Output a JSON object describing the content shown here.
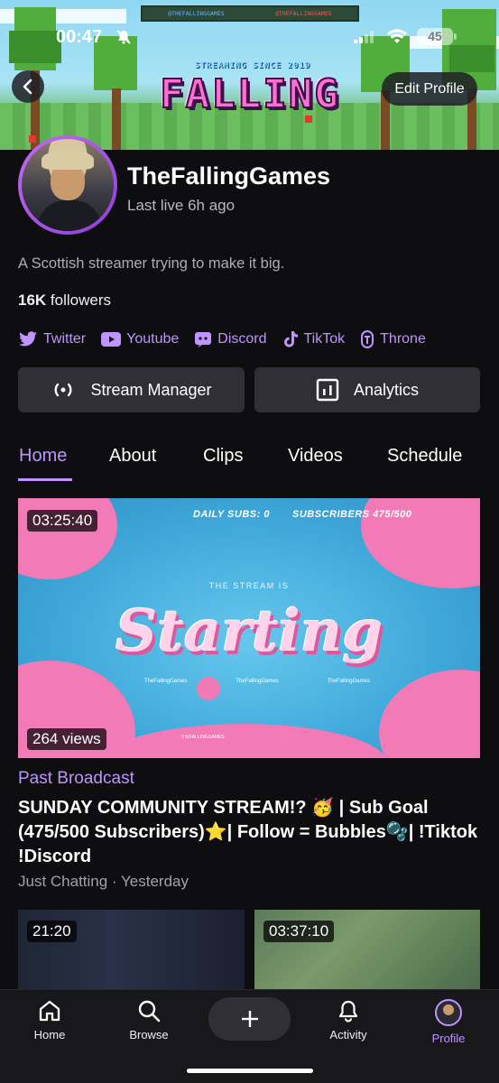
{
  "status_bar": {
    "time": "00:47",
    "battery": "45"
  },
  "banner": {
    "twitter_handle": "@THEFALLINGGAMES",
    "youtube_handle": "@THEFALLINGGAMES",
    "tagline": "STREAMING SINCE 2019",
    "logo_text": "FALLING"
  },
  "header": {
    "edit_profile_label": "Edit Profile"
  },
  "profile": {
    "channel_name": "TheFallingGames",
    "last_live": "Last live 6h ago",
    "bio": "A Scottish streamer trying to make it big.",
    "followers_count": "16K",
    "followers_label": "followers"
  },
  "links": [
    {
      "label": "Twitter",
      "icon": "twitter-icon"
    },
    {
      "label": "Youtube",
      "icon": "youtube-icon"
    },
    {
      "label": "Discord",
      "icon": "discord-icon"
    },
    {
      "label": "TikTok",
      "icon": "tiktok-icon"
    },
    {
      "label": "Throne",
      "icon": "throne-icon"
    }
  ],
  "actions": {
    "stream_manager": "Stream Manager",
    "analytics": "Analytics"
  },
  "tabs": [
    {
      "label": "Home",
      "active": true
    },
    {
      "label": "About"
    },
    {
      "label": "Clips"
    },
    {
      "label": "Videos"
    },
    {
      "label": "Schedule"
    }
  ],
  "featured_video": {
    "duration": "03:25:40",
    "views": "264 views",
    "thumbnail": {
      "daily_subs": "DAILY SUBS: 0",
      "subscribers": "SUBSCRIBERS 475/500",
      "stream_is": "THE STREAM IS",
      "starting": "Starting",
      "twitter": "TheFallingGames",
      "youtube": "TheFallingGames",
      "instagram": "TheFallingGames",
      "tag": "THEFALLINGGAMES"
    },
    "type_label": "Past Broadcast",
    "title": "SUNDAY COMMUNITY STREAM!? 🥳 | Sub Goal (475/500 Subscribers)⭐| Follow = Bubbles🫧| !Tiktok !Discord",
    "meta": "Just Chatting · Yesterday"
  },
  "more_videos": [
    {
      "duration": "21:20"
    },
    {
      "duration": "03:37:10"
    }
  ],
  "bottom_nav": {
    "home": "Home",
    "browse": "Browse",
    "activity": "Activity",
    "profile": "Profile"
  },
  "colors": {
    "accent": "#bf94ff",
    "background": "#0e0e10",
    "button": "#2f2f35"
  }
}
